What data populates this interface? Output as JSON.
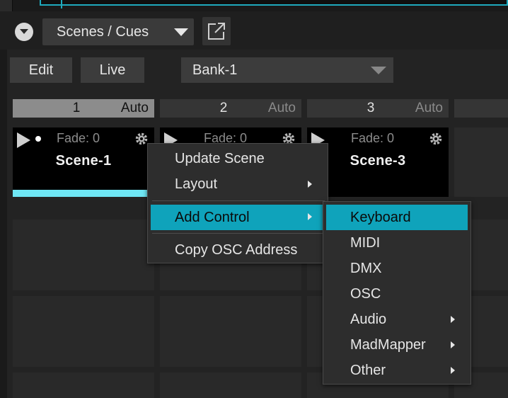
{
  "header": {
    "view_select": "Scenes / Cues",
    "edit_label": "Edit",
    "live_label": "Live",
    "bank_select": "Bank-1"
  },
  "columns": [
    {
      "number": "1",
      "mode": "Auto",
      "active": true
    },
    {
      "number": "2",
      "mode": "Auto",
      "active": false
    },
    {
      "number": "3",
      "mode": "Auto",
      "active": false
    }
  ],
  "scenes": [
    {
      "fade": "Fade: 0",
      "name": "Scene-1"
    },
    {
      "fade": "Fade: 0",
      "name": ""
    },
    {
      "fade": "Fade: 0",
      "name": "Scene-3"
    }
  ],
  "context_menu": {
    "items": [
      "Update Scene",
      "Layout",
      "Add Control",
      "Copy OSC Address"
    ]
  },
  "submenu": {
    "items": [
      "Keyboard",
      "MIDI",
      "DMX",
      "OSC",
      "Audio",
      "MadMapper",
      "Other"
    ]
  },
  "colors": {
    "accent": "#0fa3bb",
    "progress": "#6fe6f4",
    "background": "#1f1f1f"
  },
  "icons": [
    "chevron-down-icon",
    "caret-down-icon",
    "popout-icon",
    "play-icon",
    "gear-icon",
    "submenu-arrow-icon"
  ]
}
